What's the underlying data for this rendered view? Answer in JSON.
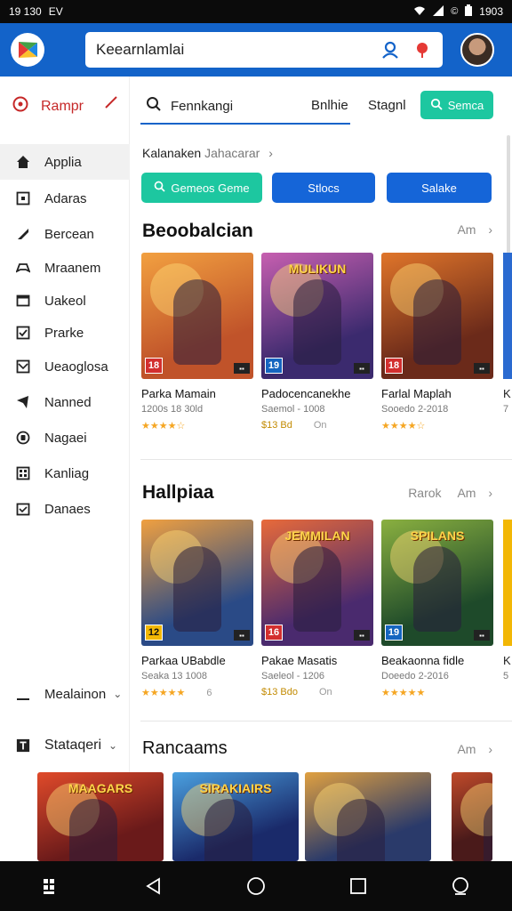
{
  "status": {
    "time": "19 130",
    "left_extra": "EV",
    "right_time": "1903"
  },
  "appbar": {
    "search_value": "Keearnlamlai"
  },
  "sidebar": {
    "header": "Rampr",
    "items": [
      {
        "label": "Applia",
        "icon": "home-icon",
        "active": true
      },
      {
        "label": "Adaras",
        "icon": "square-icon"
      },
      {
        "label": "Bercean",
        "icon": "brush-icon"
      },
      {
        "label": "Mraanem",
        "icon": "controller-icon"
      },
      {
        "label": "Uakeol",
        "icon": "window-icon"
      },
      {
        "label": "Prarke",
        "icon": "check-box-icon"
      },
      {
        "label": "Ueaoglosa",
        "icon": "mail-icon"
      },
      {
        "label": "Nanned",
        "icon": "megaphone-icon"
      },
      {
        "label": "Nagaei",
        "icon": "gamepad-icon"
      },
      {
        "label": "Kanliag",
        "icon": "grid-icon"
      },
      {
        "label": "Danaes",
        "icon": "calendar-icon"
      }
    ],
    "footer_items": [
      {
        "label": "Mealainon"
      },
      {
        "label": "Stataqeri"
      }
    ]
  },
  "tabs": {
    "search_label": "Fennkangi",
    "tab2": "Bnlhie",
    "tab3": "Stagnl",
    "button": "Semca"
  },
  "subhead": {
    "label": "Kalanaken",
    "muted": "Jahacarar"
  },
  "chips": [
    "Gemeos Geme",
    "Stlocs",
    "Salake"
  ],
  "sections": [
    {
      "title": "Beoobalcian",
      "more": "Am",
      "cards": [
        {
          "name": "Parka Mamain",
          "meta": "1200s 18 30ld",
          "rating": "★★★★☆",
          "age": "18",
          "age_color": "red",
          "bg": "#c0532a",
          "bg2": "#f2a040",
          "logo": ""
        },
        {
          "name": "Padocencanekhe",
          "meta": "Saemol - 1008",
          "rating": "$13 Bd",
          "rating2": "On",
          "age": "19",
          "age_color": "blue",
          "bg": "#3b2a6e",
          "bg2": "#c75fb0",
          "logo": "MULIKUN"
        },
        {
          "name": "Farlal Maplah",
          "meta": "Sooedo 2-2018",
          "rating": "★★★★☆",
          "age": "18",
          "age_color": "red",
          "bg": "#6b2a1a",
          "bg2": "#e0752a",
          "logo": ""
        }
      ]
    },
    {
      "title": "Hallpiaa",
      "more": "Rarok",
      "more2": "Am",
      "cards": [
        {
          "name": "Parkaa UBabdle",
          "meta": "Seaka 13 1008",
          "rating": "★★★★★",
          "rating2": "6",
          "age": "12",
          "age_color": "yellow",
          "bg": "#2a4a86",
          "bg2": "#f0a040",
          "logo": ""
        },
        {
          "name": "Pakae Masatis",
          "meta": "Saeleol - 1206",
          "rating": "$13 Bdo",
          "rating2": "On",
          "age": "16",
          "age_color": "red",
          "bg": "#4a2a6e",
          "bg2": "#e86a3a",
          "logo": "JEMMILAN"
        },
        {
          "name": "Beakaonna fidle",
          "meta": "Doeedo 2-2016",
          "rating": "★★★★★",
          "age": "19",
          "age_color": "blue",
          "bg": "#1e4a2a",
          "bg2": "#8ab040",
          "logo": "SPILANS"
        }
      ]
    },
    {
      "title": "Rancaams",
      "more": "Am",
      "cards": [
        {
          "logo": "MAAGARS",
          "bg": "#6a1a1a",
          "bg2": "#e04a2a"
        },
        {
          "logo": "SIRAKIAIRS",
          "bg": "#1a2a6a",
          "bg2": "#4aa0e0"
        },
        {
          "logo": "",
          "bg": "#2a3a6a",
          "bg2": "#e0a040"
        },
        {
          "logo": "",
          "bg": "#4a1a1a",
          "bg2": "#c04a2a"
        }
      ]
    }
  ],
  "partial_right": [
    {
      "name": "K",
      "meta": "7"
    },
    {
      "name": "K",
      "meta": "5"
    }
  ]
}
